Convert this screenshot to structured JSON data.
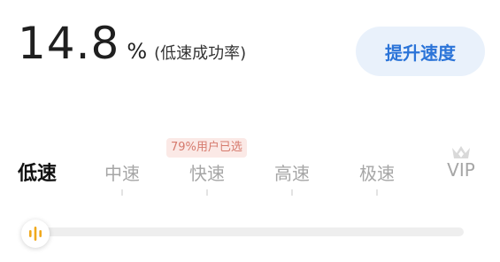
{
  "success_rate": {
    "value": "14.8",
    "unit": "%",
    "label": "(低速成功率)"
  },
  "boost_button": {
    "label": "提升速度"
  },
  "popular_badge": {
    "text": "79%用户已选"
  },
  "speed_tabs": [
    {
      "label": "低速",
      "selected": true
    },
    {
      "label": "中速",
      "selected": false
    },
    {
      "label": "快速",
      "selected": false
    },
    {
      "label": "高速",
      "selected": false
    },
    {
      "label": "极速",
      "selected": false
    },
    {
      "label": "VIP",
      "selected": false
    }
  ],
  "slider": {
    "selected_level": 0,
    "level_count": 6,
    "icon": "waveform-icon"
  },
  "colors": {
    "accent_blue": "#2b74d8",
    "button_bg": "#e9f1fb",
    "badge_bg": "#fbe9e6",
    "badge_text": "#d67a6d",
    "slider_icon": "#f0a81c"
  }
}
